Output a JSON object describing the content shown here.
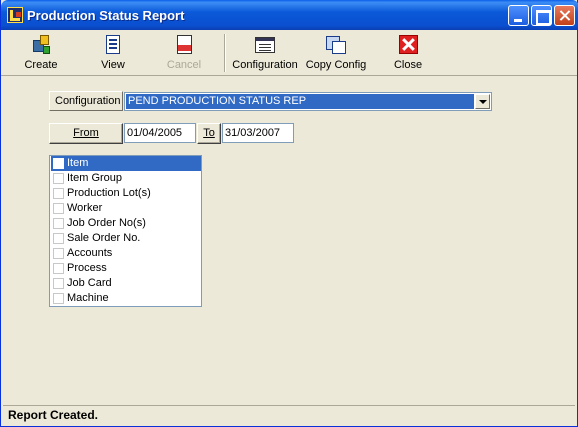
{
  "window": {
    "title": "Production Status Report"
  },
  "toolbar": {
    "create": "Create",
    "view": "View",
    "cancel": "Cancel",
    "configuration": "Configuration",
    "copy_config": "Copy Config",
    "close": "Close"
  },
  "form": {
    "configuration_label": "Configuration",
    "configuration_value": "PEND PRODUCTION STATUS REP",
    "from_label": "From",
    "from_date": "01/04/2005",
    "to_label": "To",
    "to_date": "31/03/2007"
  },
  "list": {
    "items": [
      {
        "label": "Item",
        "selected": true
      },
      {
        "label": "Item Group",
        "selected": false
      },
      {
        "label": "Production Lot(s)",
        "selected": false
      },
      {
        "label": "Worker",
        "selected": false
      },
      {
        "label": "Job Order No(s)",
        "selected": false
      },
      {
        "label": "Sale Order No.",
        "selected": false
      },
      {
        "label": "Accounts",
        "selected": false
      },
      {
        "label": "Process",
        "selected": false
      },
      {
        "label": "Job Card",
        "selected": false
      },
      {
        "label": "Machine",
        "selected": false
      }
    ]
  },
  "status": {
    "text": "Report Created."
  },
  "colors": {
    "accent": "#316ac5",
    "title_bar": "#0a5fe8",
    "face": "#ece9d8"
  }
}
